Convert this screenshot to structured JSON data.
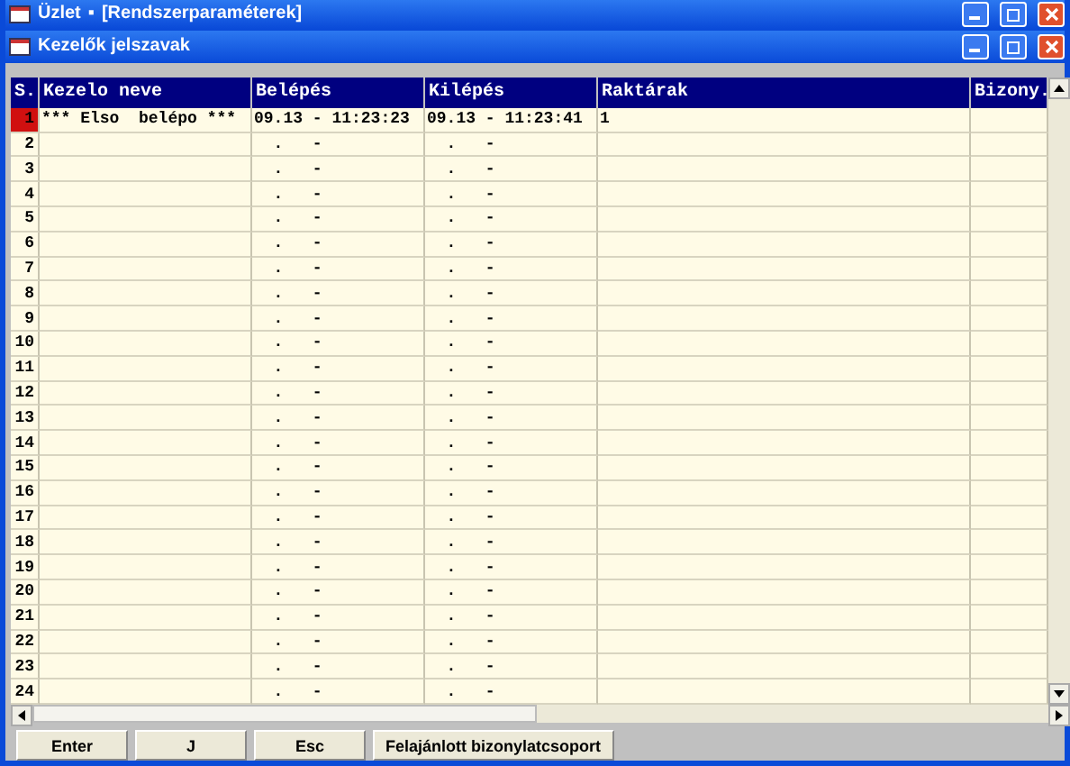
{
  "app_window": {
    "title": "Üzlet",
    "menu_marker": "▪",
    "subtitle": "[Rendszerparaméterek]"
  },
  "window": {
    "title": "Kezelők jelszavak"
  },
  "table": {
    "columns": [
      "S.",
      "Kezelo neve",
      "Belépés",
      "Kilépés",
      "Raktárak",
      "Bizony."
    ],
    "rows": [
      {
        "num": "1",
        "name": "*** Elso  belépo ***",
        "in": "09.13 - 11:23:23",
        "out": "09.13 - 11:23:41",
        "stores": "1",
        "selected": true
      },
      {
        "num": "2",
        "in": "  .   -",
        "out": "  .   -",
        "selected": false
      },
      {
        "num": "3",
        "in": "  .   -",
        "out": "  .   -",
        "selected": false
      },
      {
        "num": "4",
        "in": "  .   -",
        "out": "  .   -",
        "selected": false
      },
      {
        "num": "5",
        "in": "  .   -",
        "out": "  .   -",
        "selected": false
      },
      {
        "num": "6",
        "in": "  .   -",
        "out": "  .   -",
        "selected": false
      },
      {
        "num": "7",
        "in": "  .   -",
        "out": "  .   -",
        "selected": false
      },
      {
        "num": "8",
        "in": "  .   -",
        "out": "  .   -",
        "selected": false
      },
      {
        "num": "9",
        "in": "  .   -",
        "out": "  .   -",
        "selected": false
      },
      {
        "num": "10",
        "in": "  .   -",
        "out": "  .   -",
        "selected": false
      },
      {
        "num": "11",
        "in": "  .   -",
        "out": "  .   -",
        "selected": false
      },
      {
        "num": "12",
        "in": "  .   -",
        "out": "  .   -",
        "selected": false
      },
      {
        "num": "13",
        "in": "  .   -",
        "out": "  .   -",
        "selected": false
      },
      {
        "num": "14",
        "in": "  .   -",
        "out": "  .   -",
        "selected": false
      },
      {
        "num": "15",
        "in": "  .   -",
        "out": "  .   -",
        "selected": false
      },
      {
        "num": "16",
        "in": "  .   -",
        "out": "  .   -",
        "selected": false
      },
      {
        "num": "17",
        "in": "  .   -",
        "out": "  .   -",
        "selected": false
      },
      {
        "num": "18",
        "in": "  .   -",
        "out": "  .   -",
        "selected": false
      },
      {
        "num": "19",
        "in": "  .   -",
        "out": "  .   -",
        "selected": false
      },
      {
        "num": "20",
        "in": "  .   -",
        "out": "  .   -",
        "selected": false
      },
      {
        "num": "21",
        "in": "  .   -",
        "out": "  .   -",
        "selected": false
      },
      {
        "num": "22",
        "in": "  .   -",
        "out": "  .   -",
        "selected": false
      },
      {
        "num": "23",
        "in": "  .   -",
        "out": "  .   -",
        "selected": false
      },
      {
        "num": "24",
        "in": "  .   -",
        "out": "  .   -",
        "selected": false
      }
    ]
  },
  "buttons": [
    "Enter",
    "J",
    "Esc",
    "Felajánlott bizonylatcsoport"
  ]
}
